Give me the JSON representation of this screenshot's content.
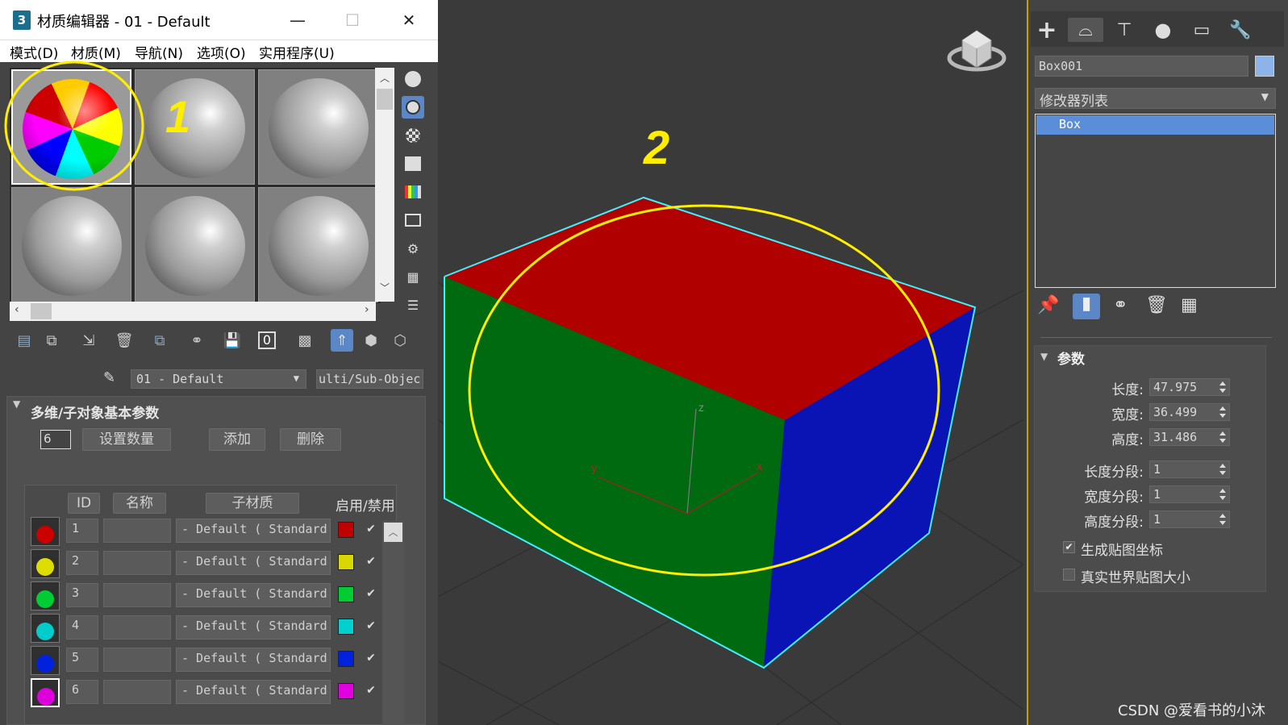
{
  "window": {
    "title": "材质编辑器 - 01 - Default",
    "icon_label": "3",
    "minimize": "—",
    "maximize": "☐",
    "close": "✕"
  },
  "menu": [
    "模式(D)",
    "材质(M)",
    "导航(N)",
    "选项(O)",
    "实用程序(U)"
  ],
  "annotations": {
    "label1": "1",
    "label2": "2",
    "color": "#ffee00"
  },
  "material_name": "01 - Default",
  "material_type": "ulti/Sub-Objec",
  "rollout": {
    "title": "多维/子对象基本参数",
    "count": "6",
    "set_count": "设置数量",
    "add": "添加",
    "delete": "删除"
  },
  "columns": {
    "id": "ID",
    "name": "名称",
    "sub": "子材质",
    "enable": "启用/禁用"
  },
  "sub_materials": [
    {
      "id": "1",
      "sub": "- Default  ( Standard",
      "color": "#c00000",
      "enabled": true
    },
    {
      "id": "2",
      "sub": "- Default  ( Standard",
      "color": "#d8d800",
      "enabled": true
    },
    {
      "id": "3",
      "sub": "- Default  ( Standard",
      "color": "#00cc33",
      "enabled": true
    },
    {
      "id": "4",
      "sub": "- Default  ( Standard",
      "color": "#00d0d0",
      "enabled": true
    },
    {
      "id": "5",
      "sub": "- Default  ( Standard",
      "color": "#0022dd",
      "enabled": true
    },
    {
      "id": "6",
      "sub": "- Default  ( Standard",
      "color": "#e000e0",
      "enabled": true
    }
  ],
  "viewport": {
    "axis_x": "x",
    "axis_y": "y",
    "axis_z": "z"
  },
  "command_panel": {
    "object_name": "Box001",
    "modifier_list": "修改器列表",
    "stack_item": "Box",
    "params_title": "参数",
    "params": [
      {
        "label": "长度:",
        "value": "47.975"
      },
      {
        "label": "宽度:",
        "value": "36.499"
      },
      {
        "label": "高度:",
        "value": "31.486"
      },
      {
        "label": "长度分段:",
        "value": "1"
      },
      {
        "label": "宽度分段:",
        "value": "1"
      },
      {
        "label": "高度分段:",
        "value": "1"
      }
    ],
    "gen_map": "生成贴图坐标",
    "real_world": "真实世界贴图大小"
  },
  "watermark": "CSDN @爱看书的小沐"
}
